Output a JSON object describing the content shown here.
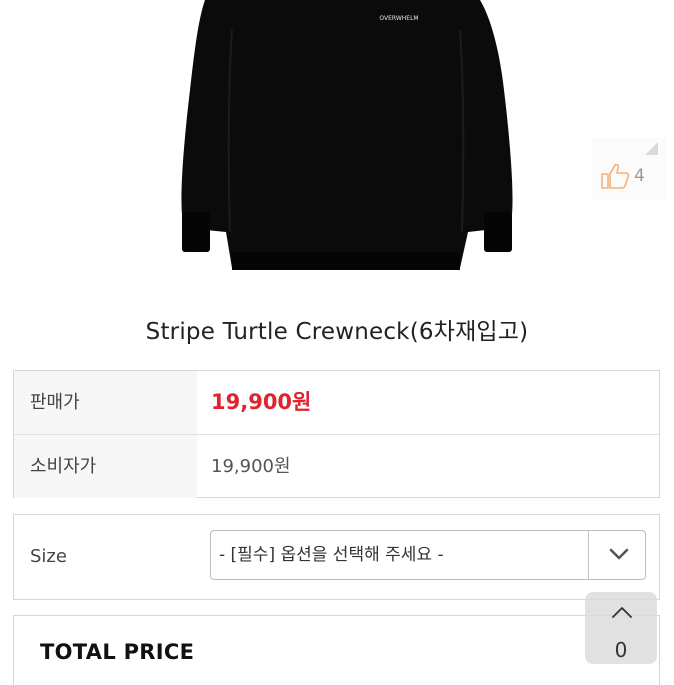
{
  "product": {
    "brand_print": "OVERWHELM",
    "title": "Stripe Turtle Crewneck(6차재입고)",
    "likes": "4"
  },
  "prices": {
    "sale_label": "판매가",
    "sale_value": "19,900원",
    "retail_label": "소비자가",
    "retail_value": "19,900원"
  },
  "option": {
    "label": "Size",
    "selected": "- [필수] 옵션을 선택해 주세요 -"
  },
  "total": {
    "label": "TOTAL PRICE"
  },
  "scroll_top": {
    "count": "0"
  },
  "colors": {
    "sale": "#e0242f",
    "garment": "#0b0b0b"
  }
}
